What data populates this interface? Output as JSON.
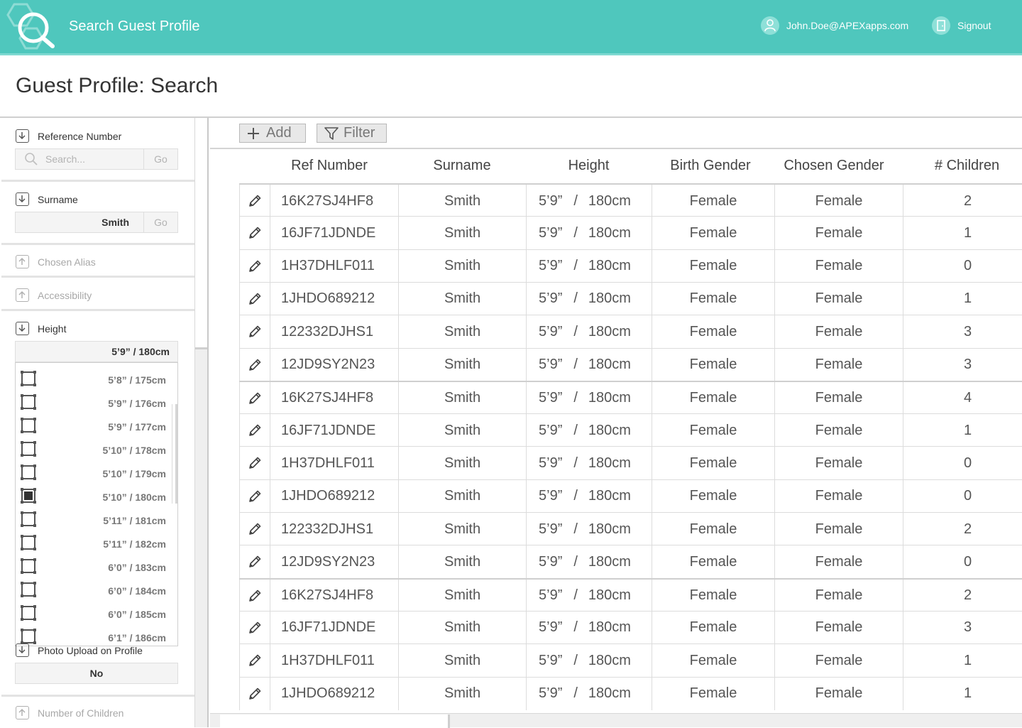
{
  "header": {
    "app_title": "Search Guest Profile",
    "user_email": "John.Doe@APEXapps.com",
    "signout_label": "Signout",
    "accent_color": "#4fc7bd"
  },
  "page": {
    "title": "Guest Profile: Search"
  },
  "sidebar": {
    "reference": {
      "label": "Reference Number",
      "placeholder": "Search...",
      "go_label": "Go",
      "state": "expanded"
    },
    "surname": {
      "label": "Surname",
      "value": "Smith",
      "go_label": "Go",
      "state": "expanded"
    },
    "alias": {
      "label": "Chosen Alias",
      "state": "collapsed"
    },
    "accessibility": {
      "label": "Accessibility",
      "state": "collapsed"
    },
    "height": {
      "label": "Height",
      "selected": "5’9”  /  180cm",
      "options": [
        {
          "label": "5’8”  /  175cm",
          "checked": false
        },
        {
          "label": "5’9”  /  176cm",
          "checked": false
        },
        {
          "label": "5’9”  /  177cm",
          "checked": false
        },
        {
          "label": "5’10”  /  178cm",
          "checked": false
        },
        {
          "label": "5’10”  /  179cm",
          "checked": false
        },
        {
          "label": "5’10”  /  180cm",
          "checked": true
        },
        {
          "label": "5’11”  /  181cm",
          "checked": false
        },
        {
          "label": "5’11”  /  182cm",
          "checked": false
        },
        {
          "label": "6’0”  /  183cm",
          "checked": false
        },
        {
          "label": "6’0”  /  184cm",
          "checked": false
        },
        {
          "label": "6’0”  /  185cm",
          "checked": false
        },
        {
          "label": "6’1”  /  186cm",
          "checked": false
        }
      ]
    },
    "photo": {
      "label": "Photo Upload on Profile",
      "value": "No"
    },
    "children": {
      "label": "Number of Children",
      "state": "collapsed"
    }
  },
  "toolbar": {
    "add_label": "Add",
    "filter_label": "Filter"
  },
  "table": {
    "columns": [
      "Ref Number",
      "Surname",
      "Height",
      "Birth Gender",
      "Chosen Gender",
      "# Children"
    ],
    "rows": [
      {
        "ref": "16K27SJ4HF8",
        "surname": "Smith",
        "ft": "5’9”",
        "cm": "180cm",
        "birth": "Female",
        "chosen": "Female",
        "children": "2"
      },
      {
        "ref": "16JF71JDNDE",
        "surname": "Smith",
        "ft": "5’9”",
        "cm": "180cm",
        "birth": "Female",
        "chosen": "Female",
        "children": "1"
      },
      {
        "ref": "1H37DHLF011",
        "surname": "Smith",
        "ft": "5’9”",
        "cm": "180cm",
        "birth": "Female",
        "chosen": "Female",
        "children": "0"
      },
      {
        "ref": "1JHDO689212",
        "surname": "Smith",
        "ft": "5’9”",
        "cm": "180cm",
        "birth": "Female",
        "chosen": "Female",
        "children": "1"
      },
      {
        "ref": "122332DJHS1",
        "surname": "Smith",
        "ft": "5’9”",
        "cm": "180cm",
        "birth": "Female",
        "chosen": "Female",
        "children": "3"
      },
      {
        "ref": "12JD9SY2N23",
        "surname": "Smith",
        "ft": "5’9”",
        "cm": "180cm",
        "birth": "Female",
        "chosen": "Female",
        "children": "3"
      },
      {
        "ref": "16K27SJ4HF8",
        "surname": "Smith",
        "ft": "5’9”",
        "cm": "180cm",
        "birth": "Female",
        "chosen": "Female",
        "children": "4"
      },
      {
        "ref": "16JF71JDNDE",
        "surname": "Smith",
        "ft": "5’9”",
        "cm": "180cm",
        "birth": "Female",
        "chosen": "Female",
        "children": "1"
      },
      {
        "ref": "1H37DHLF011",
        "surname": "Smith",
        "ft": "5’9”",
        "cm": "180cm",
        "birth": "Female",
        "chosen": "Female",
        "children": "0"
      },
      {
        "ref": "1JHDO689212",
        "surname": "Smith",
        "ft": "5’9”",
        "cm": "180cm",
        "birth": "Female",
        "chosen": "Female",
        "children": "0"
      },
      {
        "ref": "122332DJHS1",
        "surname": "Smith",
        "ft": "5’9”",
        "cm": "180cm",
        "birth": "Female",
        "chosen": "Female",
        "children": "2"
      },
      {
        "ref": "12JD9SY2N23",
        "surname": "Smith",
        "ft": "5’9”",
        "cm": "180cm",
        "birth": "Female",
        "chosen": "Female",
        "children": "0"
      },
      {
        "ref": "16K27SJ4HF8",
        "surname": "Smith",
        "ft": "5’9”",
        "cm": "180cm",
        "birth": "Female",
        "chosen": "Female",
        "children": "2"
      },
      {
        "ref": "16JF71JDNDE",
        "surname": "Smith",
        "ft": "5’9”",
        "cm": "180cm",
        "birth": "Female",
        "chosen": "Female",
        "children": "3"
      },
      {
        "ref": "1H37DHLF011",
        "surname": "Smith",
        "ft": "5’9”",
        "cm": "180cm",
        "birth": "Female",
        "chosen": "Female",
        "children": "1"
      },
      {
        "ref": "1JHDO689212",
        "surname": "Smith",
        "ft": "5’9”",
        "cm": "180cm",
        "birth": "Female",
        "chosen": "Female",
        "children": "1"
      }
    ]
  }
}
